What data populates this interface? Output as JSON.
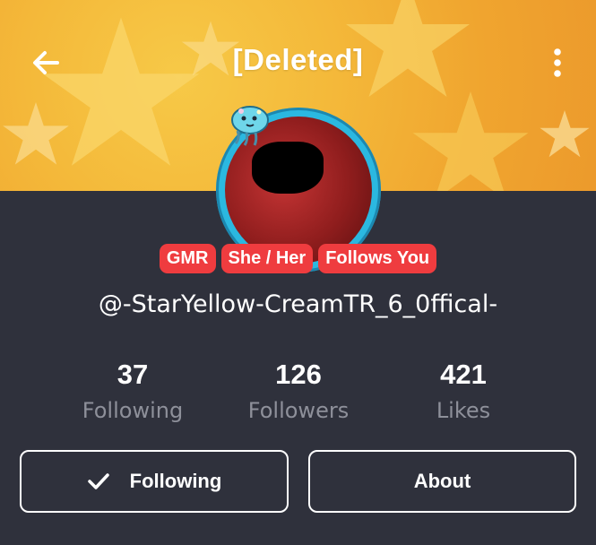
{
  "header": {
    "title": "[Deleted]",
    "back_icon": "arrow-left-icon",
    "more_icon": "more-vertical-icon"
  },
  "profile": {
    "badges": [
      {
        "label": "GMR",
        "color": "#ef3c3f"
      },
      {
        "label": "She / Her",
        "color": "#ef3c3f"
      },
      {
        "label": "Follows You",
        "color": "#ef3c3f"
      }
    ],
    "username": "@-StarYellow-CreamTR_6_0ffical-"
  },
  "stats": [
    {
      "value": "37",
      "label": "Following"
    },
    {
      "value": "126",
      "label": "Followers"
    },
    {
      "value": "421",
      "label": "Likes"
    }
  ],
  "actions": {
    "following_label": "Following",
    "about_label": "About",
    "check_icon": "check-icon"
  },
  "colors": {
    "background": "#2f313c",
    "banner": "#f4b93a",
    "badge": "#ef3c3f",
    "avatar_ring": "#2bb8e0",
    "muted_text": "#8e909a"
  }
}
